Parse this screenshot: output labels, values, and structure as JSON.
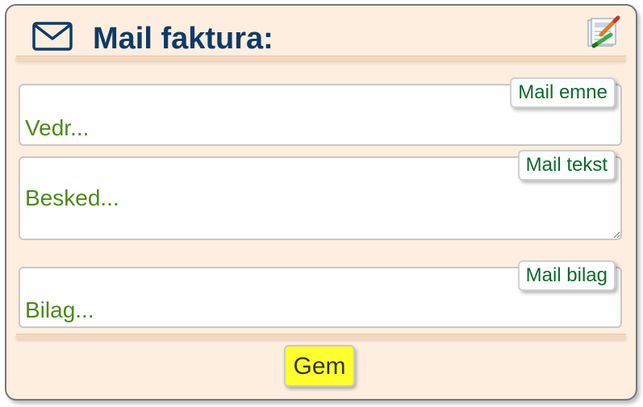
{
  "header": {
    "title": "Mail faktura:",
    "mail_icon": "envelope-icon",
    "edit_icon": "edit-document-icon"
  },
  "fields": {
    "subject": {
      "label": "Mail emne",
      "placeholder": "Vedr...",
      "value": ""
    },
    "body": {
      "label": "Mail tekst",
      "placeholder": "Besked...",
      "value": ""
    },
    "attachment": {
      "label": "Mail bilag",
      "placeholder": "Bilag...",
      "value": ""
    }
  },
  "footer": {
    "save_label": "Gem"
  },
  "colors": {
    "panel_background": "#fdeee0",
    "title_color": "#0d3b66",
    "field_text_color": "#4c8a19",
    "label_color": "#0b6b2d",
    "save_button_background": "#ffff2e"
  }
}
